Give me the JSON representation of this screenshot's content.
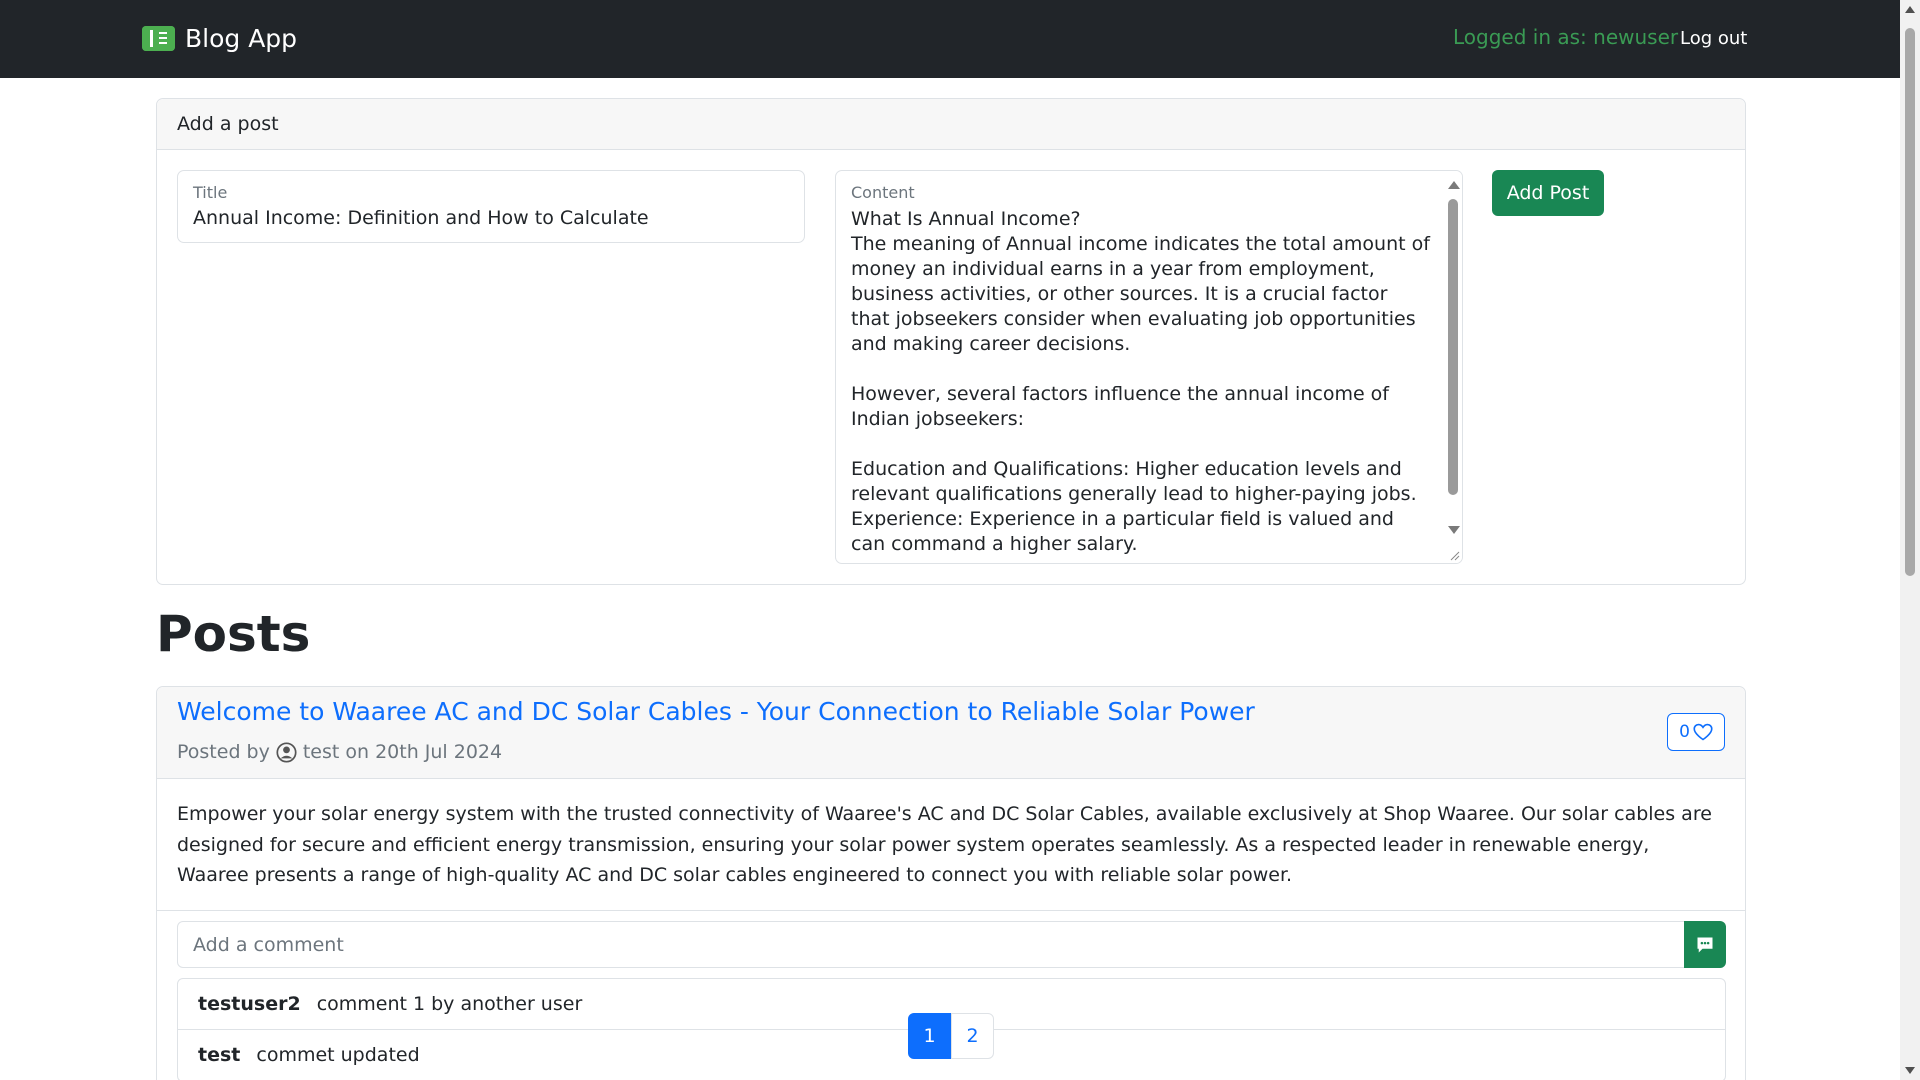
{
  "navbar": {
    "brand": "Blog App",
    "logged_in_text": "Logged in as: newuser",
    "logout_label": "Log out"
  },
  "add_post": {
    "header": "Add a post",
    "title_label": "Title",
    "title_value": "Annual Income: Definition and How to Calculate",
    "content_label": "Content",
    "content_value": "What Is Annual Income?\nThe meaning of Annual income indicates the total amount of money an individual earns in a year from employment, business activities, or other sources. It is a crucial factor that jobseekers consider when evaluating job opportunities and making career decisions.\n\nHowever, several factors influence the annual income of Indian jobseekers:\n\nEducation and Qualifications: Higher education levels and relevant qualifications generally lead to higher-paying jobs.\nExperience: Experience in a particular field is valued and can command a higher salary.",
    "submit_label": "Add Post"
  },
  "posts_heading": "Posts",
  "post": {
    "title": "Welcome to Waaree AC and DC Solar Cables - Your Connection to Reliable Solar Power",
    "posted_by_prefix": "Posted by",
    "author": "test",
    "date_text": "on 20th Jul 2024",
    "likes": "0",
    "body": "Empower your solar energy system with the trusted connectivity of Waaree's AC and DC Solar Cables, available exclusively at Shop Waaree. Our solar cables are designed for secure and efficient energy transmission, ensuring your solar power system operates seamlessly. As a respected leader in renewable energy, Waaree presents a range of high-quality AC and DC solar cables engineered to connect you with reliable solar power.",
    "comment_placeholder": "Add a comment",
    "comments": [
      {
        "user": "testuser2",
        "text": "comment 1 by another user"
      },
      {
        "user": "test",
        "text": "commet updated"
      }
    ]
  },
  "pagination": {
    "pages": [
      "1",
      "2"
    ],
    "current": "1"
  },
  "colors": {
    "navbar_bg": "#212529",
    "logged_in_text": "#3a9b54",
    "primary": "#0d6efd",
    "success": "#198754"
  }
}
